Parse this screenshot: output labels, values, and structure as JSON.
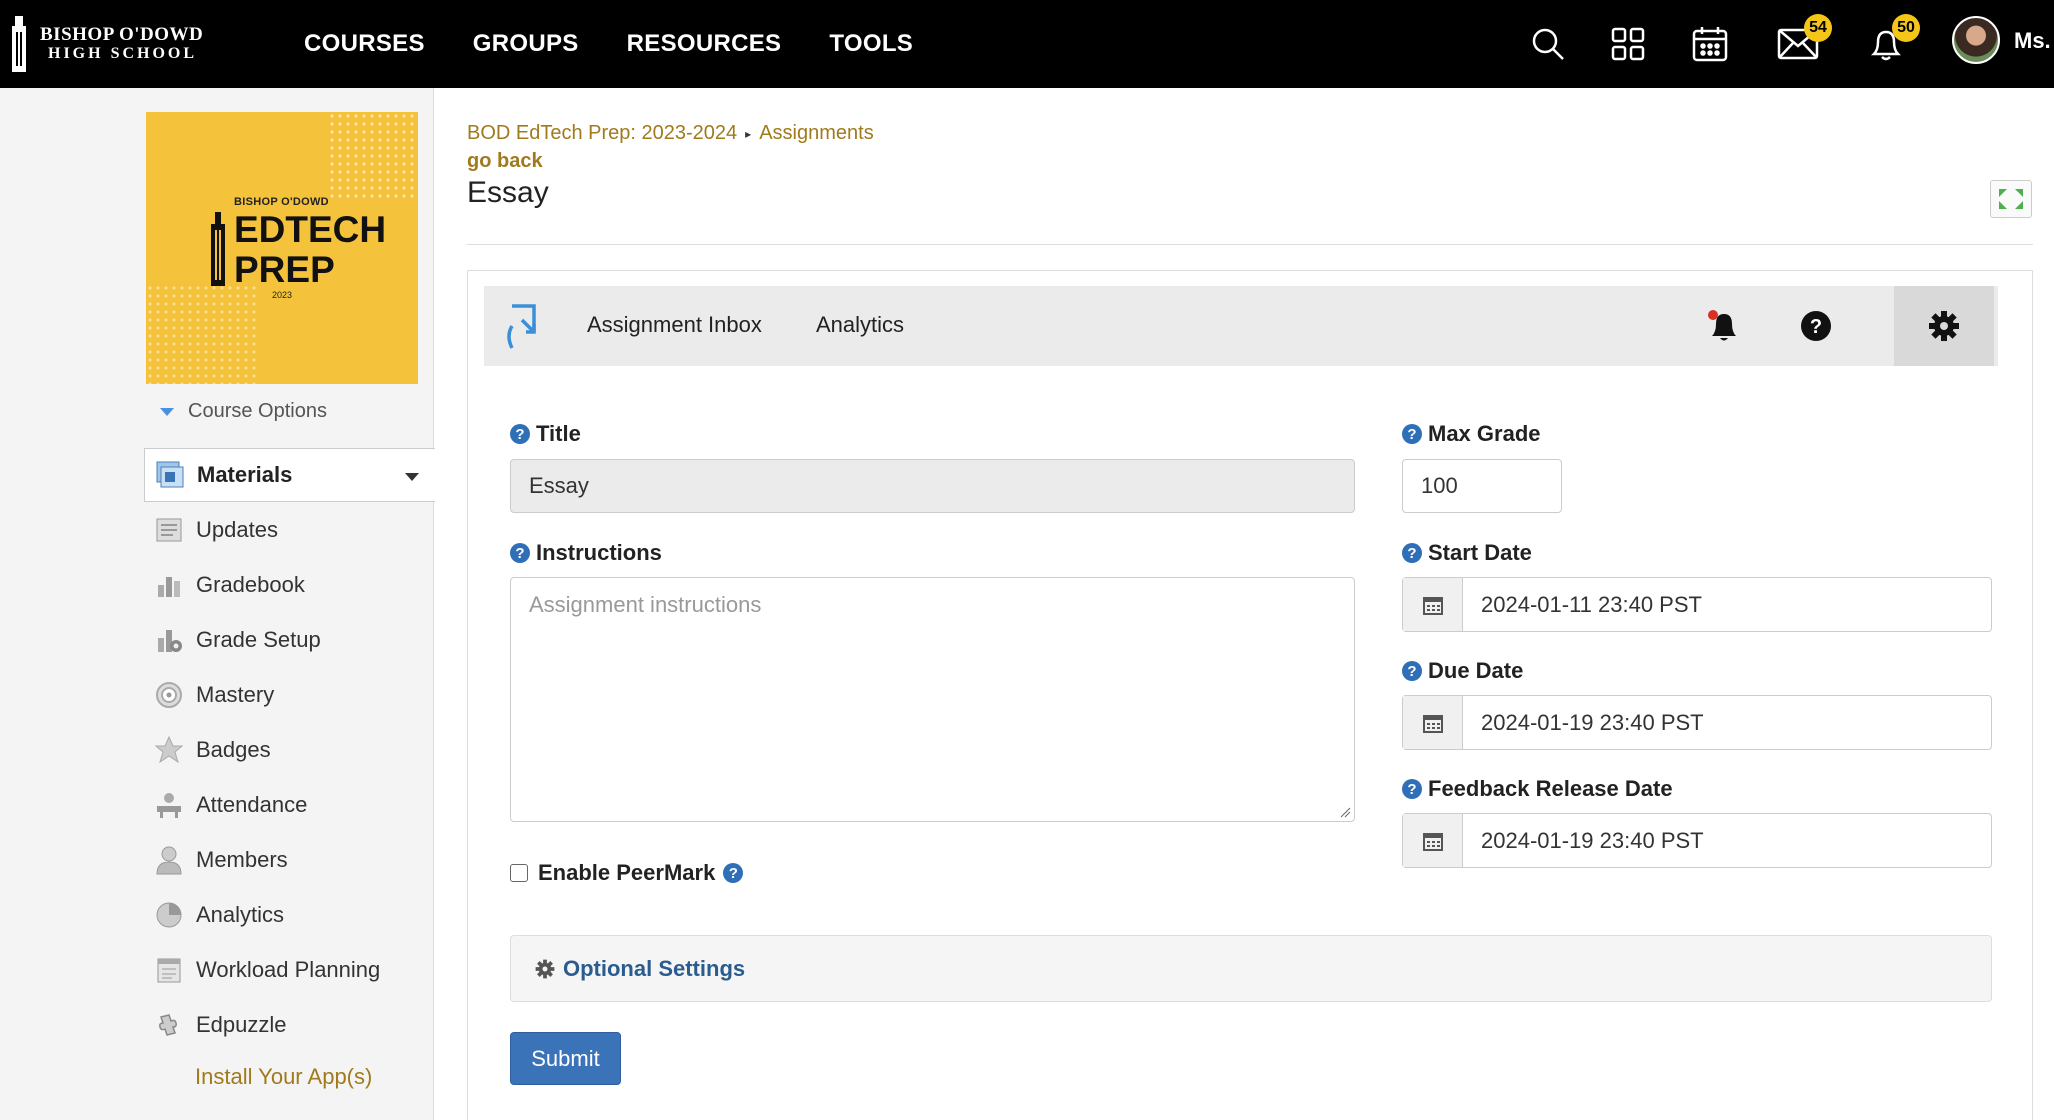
{
  "topnav": {
    "logo": {
      "line1": "BISHOP O'DOWD",
      "line2": "HIGH SCHOOL"
    },
    "links": [
      "COURSES",
      "GROUPS",
      "RESOURCES",
      "TOOLS"
    ],
    "messages_count": "54",
    "notifications_count": "50",
    "user_name": "Ms."
  },
  "sidebar": {
    "course_image": {
      "small": "BISHOP O'DOWD",
      "line1": "EDTECH",
      "line2": "PREP",
      "year": "2023"
    },
    "course_options": "Course Options",
    "active_item": "Materials",
    "items": [
      "Updates",
      "Gradebook",
      "Grade Setup",
      "Mastery",
      "Badges",
      "Attendance",
      "Members",
      "Analytics",
      "Workload Planning",
      "Edpuzzle"
    ],
    "install_link": "Install Your App(s)"
  },
  "main": {
    "breadcrumb": {
      "course": "BOD EdTech Prep: 2023-2024",
      "section": "Assignments"
    },
    "go_back": "go back",
    "title": "Essay"
  },
  "assignment_toolbar": {
    "tabs": [
      "Assignment Inbox",
      "Analytics"
    ]
  },
  "form": {
    "title_label": "Title",
    "title_value": "Essay",
    "instructions_label": "Instructions",
    "instructions_placeholder": "Assignment instructions",
    "peermark_label": "Enable PeerMark",
    "max_grade_label": "Max Grade",
    "max_grade_value": "100",
    "start_date_label": "Start Date",
    "start_date_value": "2024-01-11 23:40 PST",
    "due_date_label": "Due Date",
    "due_date_value": "2024-01-19 23:40 PST",
    "feedback_label": "Feedback Release Date",
    "feedback_value": "2024-01-19 23:40 PST",
    "optional_settings": "Optional Settings",
    "submit": "Submit"
  },
  "colors": {
    "link_gold": "#a07a1c",
    "primary_blue": "#3b73b9",
    "badge_yellow": "#f5c518",
    "course_yellow": "#f5c33b"
  }
}
